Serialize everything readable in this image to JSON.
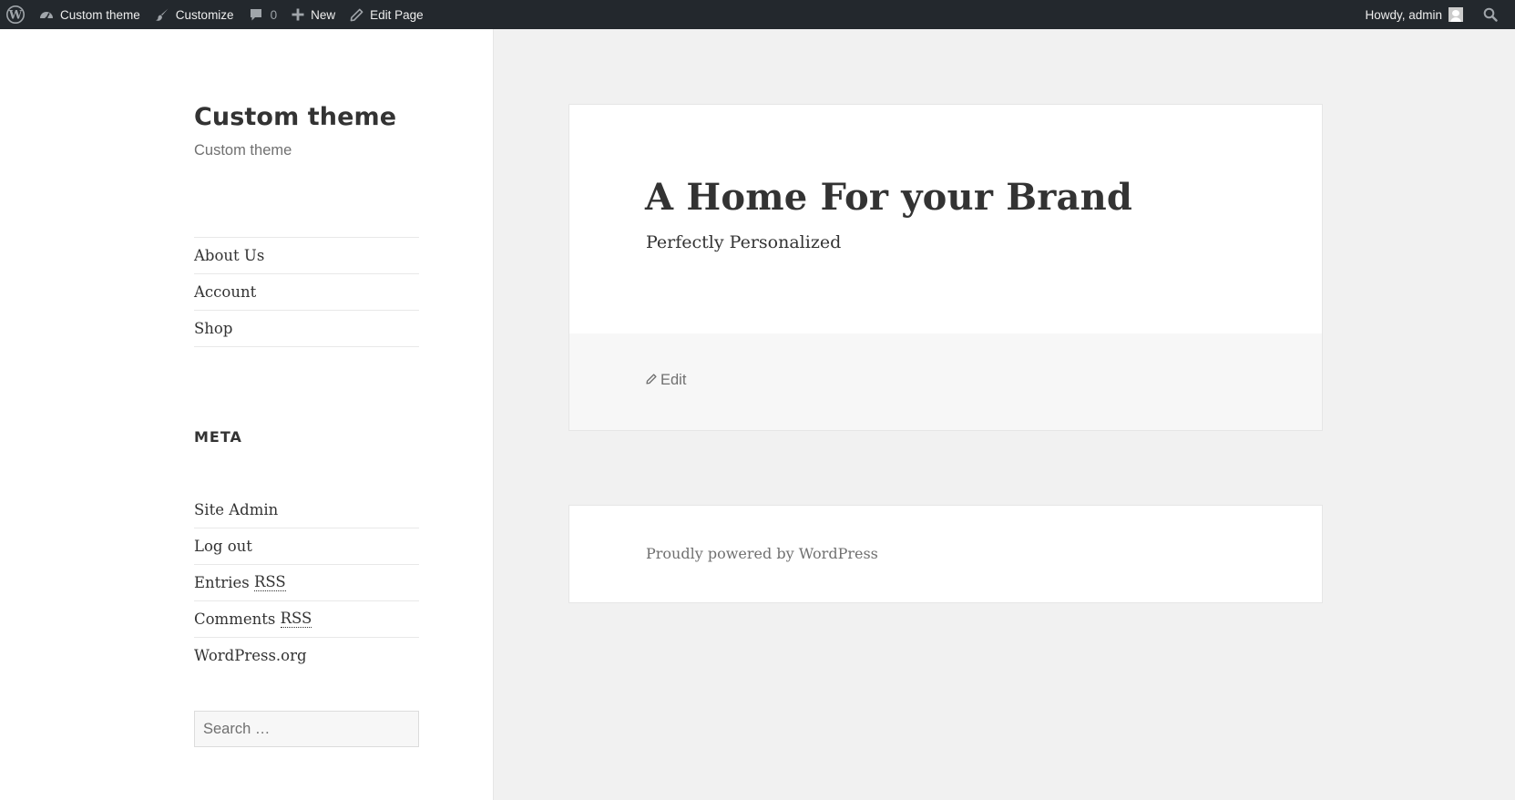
{
  "admin_bar": {
    "site_name": "Custom theme",
    "customize_label": "Customize",
    "comments_count": "0",
    "new_label": "New",
    "edit_page_label": "Edit Page",
    "greeting": "Howdy, admin"
  },
  "sidebar": {
    "site_title": "Custom theme",
    "site_description": "Custom theme",
    "nav_items": [
      {
        "label": "About Us"
      },
      {
        "label": "Account"
      },
      {
        "label": "Shop"
      }
    ],
    "meta_title": "META",
    "meta_items": [
      {
        "label": "Site Admin"
      },
      {
        "label": "Log out"
      },
      {
        "label": "Entries ",
        "abbr": "RSS"
      },
      {
        "label": "Comments ",
        "abbr": "RSS"
      },
      {
        "label": "WordPress.org"
      }
    ],
    "search_placeholder": "Search …"
  },
  "main": {
    "title": "A Home For your Brand",
    "subtitle": "Perfectly Personalized",
    "edit_label": "Edit",
    "footer_text": "Proudly powered by WordPress"
  },
  "colors": {
    "admin_bar_bg": "#23282d",
    "page_bg": "#f1f1f1",
    "text": "#333333",
    "muted_text": "#707070"
  }
}
